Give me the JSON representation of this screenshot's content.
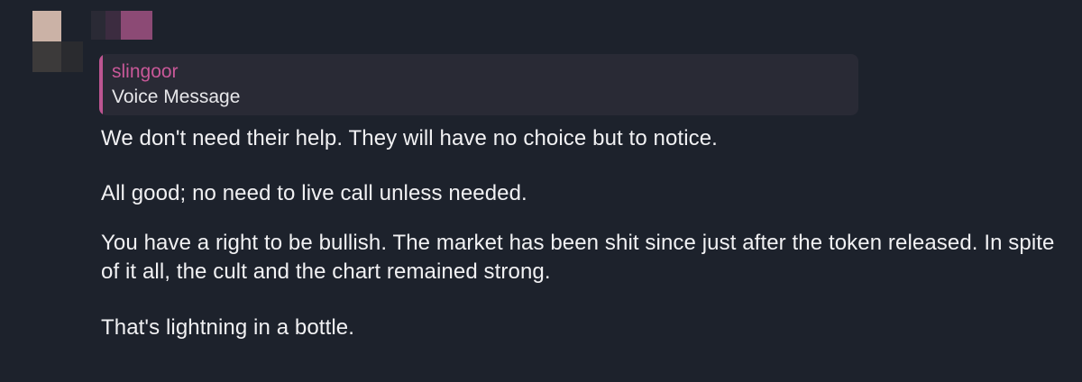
{
  "reply": {
    "author": "slingoor",
    "text": "Voice Message"
  },
  "messages": [
    "We don't need their help. They will have no choice but to notice.",
    "All good; no need to live call unless needed.",
    "You have a right to be bullish. The market has been shit since just after the token released. In spite of it all, the cult and the chart remained strong.",
    "That's lightning in a bottle."
  ],
  "colors": {
    "background": "#1d222c",
    "reply_background": "#292a35",
    "accent": "#bd5591",
    "author": "#c85898",
    "text": "#f1f1f3"
  }
}
